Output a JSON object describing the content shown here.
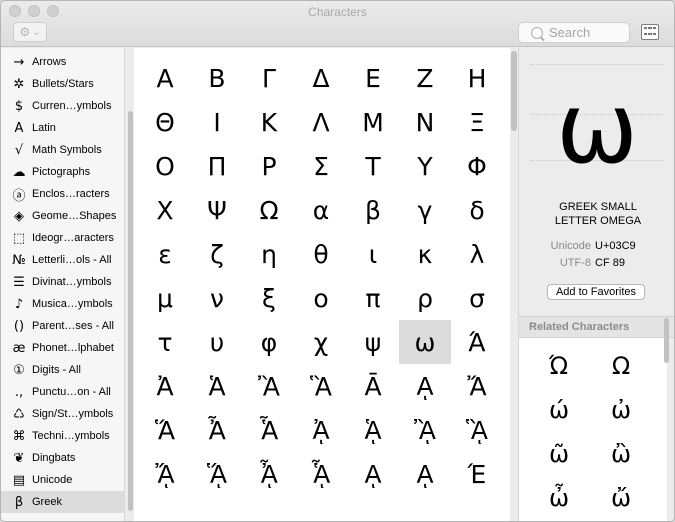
{
  "window": {
    "title": "Characters"
  },
  "toolbar": {
    "gear_label": "⚙",
    "gear_chevron": "⌄",
    "search_placeholder": "Search"
  },
  "sidebar": {
    "items": [
      {
        "icon": "→",
        "label": "Arrows",
        "icon_name": "arrow-icon"
      },
      {
        "icon": "✲",
        "label": "Bullets/Stars",
        "icon_name": "star-icon"
      },
      {
        "icon": "$",
        "label": "Curren…ymbols",
        "icon_name": "dollar-icon"
      },
      {
        "icon": "A",
        "label": "Latin",
        "icon_name": "latin-a-icon"
      },
      {
        "icon": "√",
        "label": "Math Symbols",
        "icon_name": "sqrt-icon"
      },
      {
        "icon": "☁",
        "label": "Pictographs",
        "icon_name": "cloud-icon"
      },
      {
        "icon": "ⓐ",
        "label": "Enclos…racters",
        "icon_name": "circled-a-icon"
      },
      {
        "icon": "◈",
        "label": "Geome…Shapes",
        "icon_name": "diamond-icon"
      },
      {
        "icon": "⬚",
        "label": "Ideogr…aracters",
        "icon_name": "dashed-box-icon"
      },
      {
        "icon": "№",
        "label": "Letterli…ols - All",
        "icon_name": "numero-icon"
      },
      {
        "icon": "☰",
        "label": "Divinat…ymbols",
        "icon_name": "trigram-icon"
      },
      {
        "icon": "♪",
        "label": "Musica…ymbols",
        "icon_name": "music-note-icon"
      },
      {
        "icon": "()",
        "label": "Parent…ses - All",
        "icon_name": "parentheses-icon"
      },
      {
        "icon": "æ",
        "label": "Phonet…lphabet",
        "icon_name": "ae-icon"
      },
      {
        "icon": "①",
        "label": "Digits - All",
        "icon_name": "digit-icon"
      },
      {
        "icon": ".,",
        "label": "Punctu…on - All",
        "icon_name": "punctuation-icon"
      },
      {
        "icon": "♺",
        "label": "Sign/St…ymbols",
        "icon_name": "recycle-icon"
      },
      {
        "icon": "⌘",
        "label": "Techni…ymbols",
        "icon_name": "command-icon"
      },
      {
        "icon": "❦",
        "label": "Dingbats",
        "icon_name": "dingbat-icon"
      },
      {
        "icon": "▤",
        "label": "Unicode",
        "icon_name": "unicode-icon"
      },
      {
        "icon": "β",
        "label": "Greek",
        "icon_name": "beta-icon",
        "selected": true
      }
    ]
  },
  "grid": {
    "rows": [
      [
        "Α",
        "Β",
        "Γ",
        "Δ",
        "Ε",
        "Ζ",
        "Η"
      ],
      [
        "Θ",
        "Ι",
        "Κ",
        "Λ",
        "Μ",
        "Ν",
        "Ξ"
      ],
      [
        "Ο",
        "Π",
        "Ρ",
        "Σ",
        "Τ",
        "Υ",
        "Φ"
      ],
      [
        "Χ",
        "Ψ",
        "Ω",
        "α",
        "β",
        "γ",
        "δ"
      ],
      [
        "ε",
        "ζ",
        "η",
        "θ",
        "ι",
        "κ",
        "λ"
      ],
      [
        "μ",
        "ν",
        "ξ",
        "ο",
        "π",
        "ρ",
        "σ"
      ],
      [
        "τ",
        "υ",
        "φ",
        "χ",
        "ψ",
        "ω",
        "Ά"
      ],
      [
        "Ἀ",
        "Ἁ",
        "Ἂ",
        "Ἃ",
        "Ᾱ",
        "ᾼ",
        "Ἄ"
      ],
      [
        "Ἅ",
        "Ἆ",
        "Ἇ",
        "ᾈ",
        "ᾉ",
        "ᾊ",
        "ᾋ"
      ],
      [
        "ᾌ",
        "ᾍ",
        "ᾎ",
        "ᾏ",
        "ᾼ",
        "ᾼ",
        "Έ"
      ]
    ],
    "selected": [
      6,
      5
    ]
  },
  "detail": {
    "glyph": "ω",
    "name_line1": "GREEK SMALL",
    "name_line2": "LETTER OMEGA",
    "unicode_label": "Unicode",
    "unicode_value": "U+03C9",
    "utf8_label": "UTF-8",
    "utf8_value": "CF 89",
    "favorites_button": "Add to Favorites",
    "related_header": "Related Characters",
    "related": [
      [
        "Ώ",
        "Ω"
      ],
      [
        "ώ",
        "ὠ"
      ],
      [
        "ῶ",
        "ὢ"
      ],
      [
        "ὦ",
        "ὤ"
      ]
    ]
  }
}
